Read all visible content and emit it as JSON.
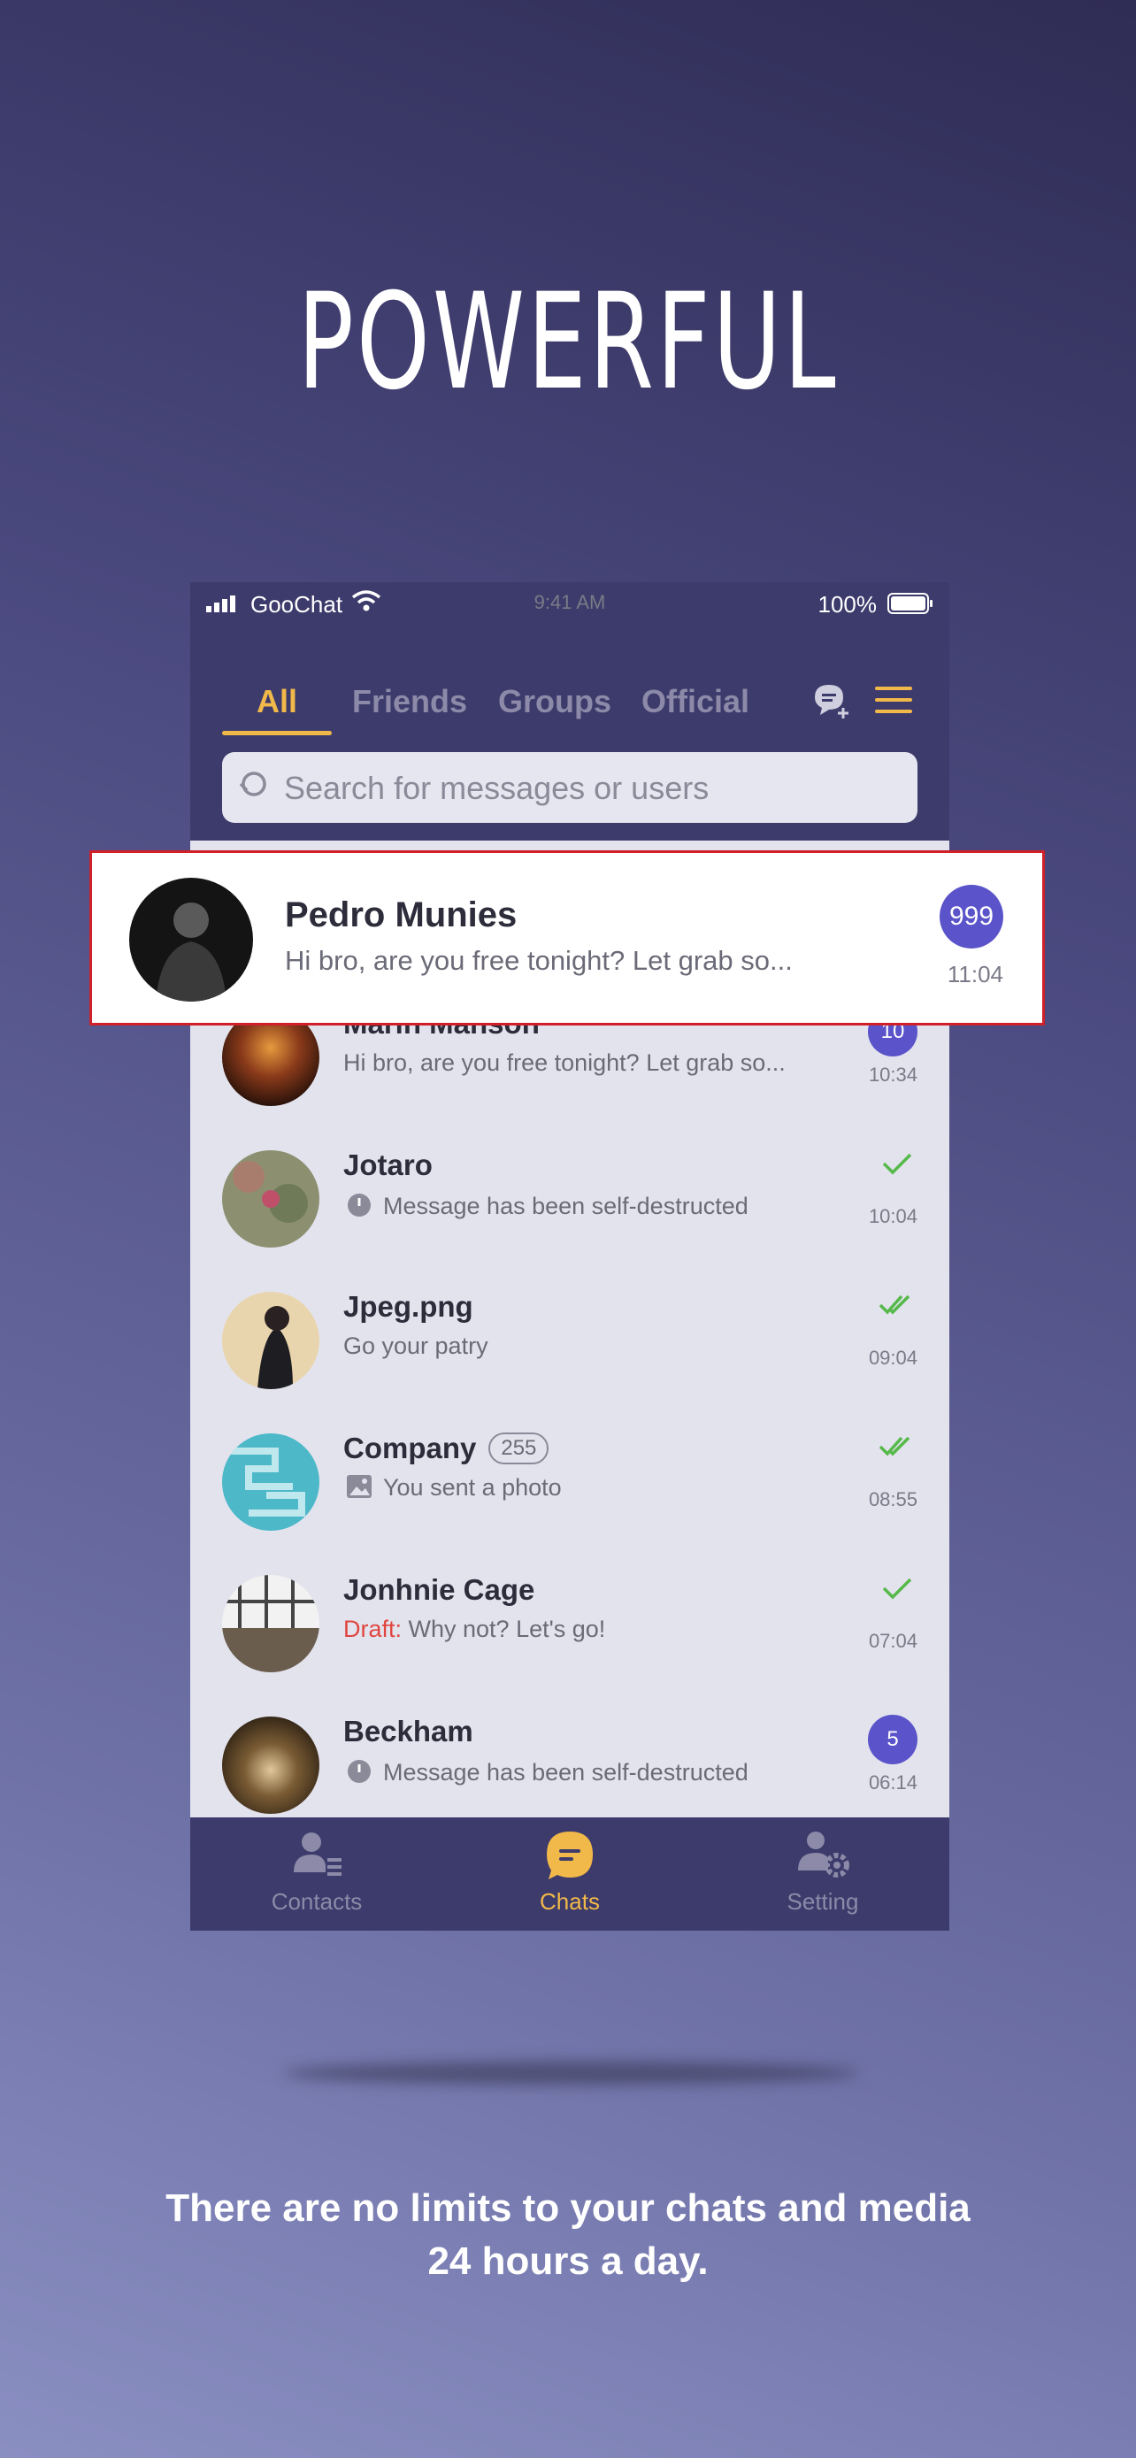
{
  "headline": "POWERFUL",
  "tagline_line1": "There are no limits to your chats and media",
  "tagline_line2": "24 hours a day.",
  "status_bar": {
    "carrier": "GooChat",
    "time": "9:41 AM",
    "battery": "100%"
  },
  "tabs": [
    "All",
    "Friends",
    "Groups",
    "Official"
  ],
  "search": {
    "placeholder": "Search for messages or users"
  },
  "highlighted_chat": {
    "name": "Pedro Munies",
    "message": "Hi bro, are you free tonight? Let grab so...",
    "badge": "999",
    "time": "11:04"
  },
  "chats": [
    {
      "name": "Marin Manson",
      "message": "Hi bro, are you free tonight? Let grab so...",
      "badge": "10",
      "time": "10:34"
    },
    {
      "name": "Jotaro",
      "message": "Message has been self-destructed",
      "time": "10:04"
    },
    {
      "name": "Jpeg.png",
      "message": "Go your patry",
      "time": "09:04"
    },
    {
      "name": "Company",
      "member_count": "255",
      "message": "You sent a photo",
      "time": "08:55"
    },
    {
      "name": "Jonhnie Cage",
      "draft_label": "Draft:",
      "message": " Why not? Let's go!",
      "time": "07:04"
    },
    {
      "name": "Beckham",
      "message": "Message has been self-destructed",
      "badge": "5",
      "time": "06:14"
    }
  ],
  "bottom_nav": [
    "Contacts",
    "Chats",
    "Setting"
  ],
  "colors": {
    "accent": "#f1b84a",
    "badge": "#5a53c9",
    "header": "#3d3b6b",
    "check": "#56b94a",
    "draft": "#e0463f"
  }
}
